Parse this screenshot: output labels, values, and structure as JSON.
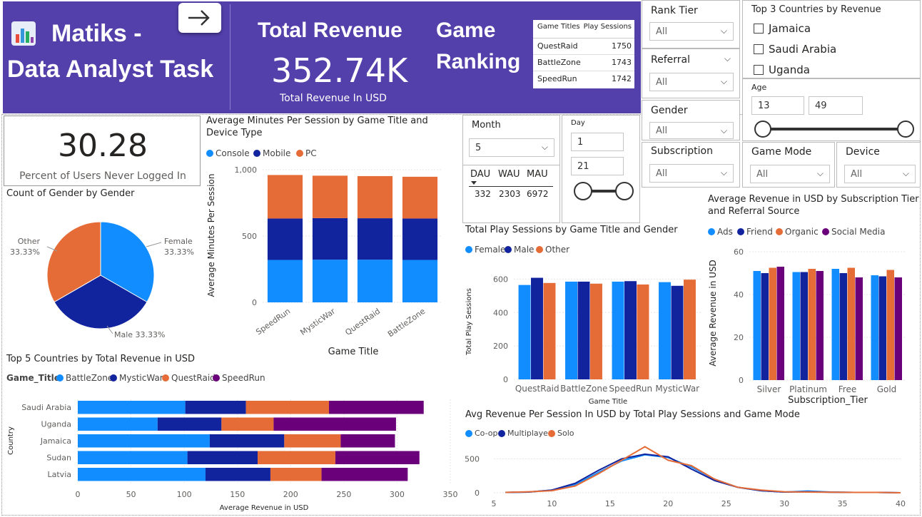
{
  "header": {
    "app_title": "Matiks -\nData Analyst Task",
    "title_line1": "Matiks -",
    "title_line2": "Data Analyst Task",
    "revenue_title": "Total Revenue",
    "revenue_value": "352.74K",
    "revenue_sub": "Total Revenue In USD",
    "ranking_line1": "Game",
    "ranking_line2": "Ranking",
    "ranking_table": {
      "headers": [
        "Game Titles",
        "Play Sessions"
      ],
      "rows": [
        {
          "title": "QuestRaid",
          "sessions": "1750"
        },
        {
          "title": "BattleZone",
          "sessions": "1743"
        },
        {
          "title": "SpeedRun",
          "sessions": "1742"
        }
      ]
    }
  },
  "kpi": {
    "value": "30.28",
    "label": "Percent of Users Never Logged In"
  },
  "slicers": {
    "rank_tier": {
      "title": "Rank Tier",
      "value": "All"
    },
    "referral": {
      "title": "Referral",
      "value": "All"
    },
    "gender": {
      "title": "Gender",
      "value": "All"
    },
    "subscription": {
      "title": "Subscription",
      "value": "All"
    },
    "game_mode": {
      "title": "Game Mode",
      "value": "All"
    },
    "device": {
      "title": "Device",
      "value": "All"
    },
    "month": {
      "title": "Month",
      "value": "5"
    },
    "day": {
      "title": "Day",
      "min": "1",
      "max": "21"
    },
    "age": {
      "title": "Age",
      "min": "13",
      "max": "49"
    },
    "top3": {
      "title": "Top 3 Countries by Revenue",
      "items": [
        "Jamaica",
        "Saudi Arabia",
        "Uganda"
      ]
    }
  },
  "active_users": {
    "headers": [
      "DAU",
      "WAU",
      "MAU"
    ],
    "values": [
      "332",
      "2303",
      "6972"
    ]
  },
  "colors": {
    "header": "#5340ab",
    "c1": "#118dff",
    "c2": "#12239e",
    "c3": "#e66c37",
    "c4": "#6b007b"
  },
  "chart_data": [
    {
      "id": "gender_pie",
      "type": "pie",
      "title": "Count of Gender by Gender",
      "labels": [
        "Female",
        "Male",
        "Other"
      ],
      "values": [
        33.33,
        33.33,
        33.33
      ],
      "label_text": [
        "Female\n33.33%",
        "Male 33.33%",
        "Other\n33.33%"
      ]
    },
    {
      "id": "avg_minutes",
      "type": "bar",
      "stacked": true,
      "title": "Average Minutes Per Session by Game Title and Device Type",
      "xlabel": "Game Title",
      "ylabel": "Average Minutes Per Session",
      "categories": [
        "SpeedRun",
        "MysticWar",
        "QuestRaid",
        "BattleZone"
      ],
      "series": [
        {
          "name": "Console",
          "values": [
            320,
            322,
            322,
            320
          ]
        },
        {
          "name": "Mobile",
          "values": [
            312,
            313,
            312,
            312
          ]
        },
        {
          "name": "PC",
          "values": [
            328,
            320,
            318,
            315
          ]
        }
      ],
      "yticks": [
        "0",
        "500",
        "1,000"
      ],
      "ylim": [
        0,
        1000
      ]
    },
    {
      "id": "play_sessions",
      "type": "bar",
      "title": "Total Play Sessions by Game Title and Gender",
      "xlabel": "Game Title",
      "ylabel": "Total Play Sessions",
      "categories": [
        "QuestRaid",
        "BattleZone",
        "SpeedRun",
        "MysticWar"
      ],
      "series": [
        {
          "name": "Female",
          "values": [
            565,
            585,
            585,
            582
          ]
        },
        {
          "name": "Male",
          "values": [
            608,
            585,
            588,
            560
          ]
        },
        {
          "name": "Other",
          "values": [
            577,
            573,
            568,
            597
          ]
        }
      ],
      "yticks": [
        "0",
        "200",
        "400",
        "600"
      ],
      "ylim": [
        0,
        700
      ]
    },
    {
      "id": "avg_revenue_sub",
      "type": "bar",
      "title": "Average Revenue in USD by Subscription Tier and Referral Source",
      "xlabel": "Subscription_Tier",
      "ylabel": "Average Revenue in USD",
      "categories": [
        "Silver",
        "Platinum",
        "Free",
        "Gold"
      ],
      "series": [
        {
          "name": "Ads",
          "values": [
            51,
            50.5,
            52,
            49
          ]
        },
        {
          "name": "Friend",
          "values": [
            50,
            50.5,
            50,
            48.5
          ]
        },
        {
          "name": "Organic",
          "values": [
            52.5,
            52,
            52.5,
            51.5
          ]
        },
        {
          "name": "Social Media",
          "values": [
            53,
            51,
            48,
            48
          ]
        }
      ],
      "yticks": [
        "0",
        "20",
        "40",
        "60"
      ],
      "ylim": [
        0,
        62
      ]
    },
    {
      "id": "top5_countries",
      "type": "bar",
      "orientation": "horizontal",
      "stacked": true,
      "title": "Top 5 Countries by Total Revenue in USD",
      "legend_title": "Game_Title",
      "xlabel": "Average Revenue in USD",
      "ylabel": "Country",
      "categories": [
        "Saudi Arabia",
        "Uganda",
        "Jamaica",
        "Sudan",
        "Latvia"
      ],
      "series": [
        {
          "name": "BattleZone",
          "values": [
            101,
            75,
            124,
            103,
            120
          ]
        },
        {
          "name": "MysticWar",
          "values": [
            57,
            60,
            70,
            66,
            61
          ]
        },
        {
          "name": "QuestRaid",
          "values": [
            78,
            49,
            53,
            73,
            48
          ]
        },
        {
          "name": "SpeedRun",
          "values": [
            89,
            115,
            51,
            79,
            81
          ]
        }
      ],
      "xticks": [
        "0",
        "50",
        "100",
        "150",
        "200",
        "250",
        "300",
        "350"
      ],
      "xlim": [
        0,
        350
      ]
    },
    {
      "id": "avg_rev_session",
      "type": "line",
      "title": "Avg Revenue Per Session In USD by Total Play Sessions and Game Mode",
      "series": [
        {
          "name": "Co-op",
          "x": [
            6,
            8,
            10,
            12,
            14,
            16,
            18,
            20,
            22,
            24,
            26,
            28,
            30,
            32,
            34,
            36,
            38,
            40
          ],
          "y": [
            5,
            10,
            40,
            120,
            300,
            470,
            560,
            520,
            380,
            200,
            80,
            30,
            10,
            25,
            10,
            5,
            5,
            0
          ]
        },
        {
          "name": "Multiplayer",
          "x": [
            6,
            8,
            10,
            12,
            14,
            16,
            18,
            20,
            22,
            24,
            26,
            28,
            30,
            32,
            34,
            36,
            38,
            40
          ],
          "y": [
            5,
            10,
            40,
            140,
            330,
            500,
            570,
            530,
            350,
            180,
            80,
            30,
            10,
            15,
            8,
            5,
            5,
            0
          ]
        },
        {
          "name": "Solo",
          "x": [
            6,
            8,
            10,
            12,
            14,
            16,
            18,
            20,
            22,
            24,
            26,
            28,
            30,
            32,
            34,
            36,
            38,
            40
          ],
          "y": [
            5,
            15,
            30,
            100,
            280,
            480,
            680,
            480,
            400,
            200,
            80,
            40,
            15,
            10,
            8,
            5,
            5,
            0
          ]
        }
      ],
      "xticks": [
        "5",
        "10",
        "15",
        "20",
        "25",
        "30",
        "35",
        "40"
      ],
      "yticks": [
        "0",
        "500"
      ],
      "xlim": [
        5,
        40
      ],
      "ylim": [
        0,
        800
      ]
    }
  ]
}
